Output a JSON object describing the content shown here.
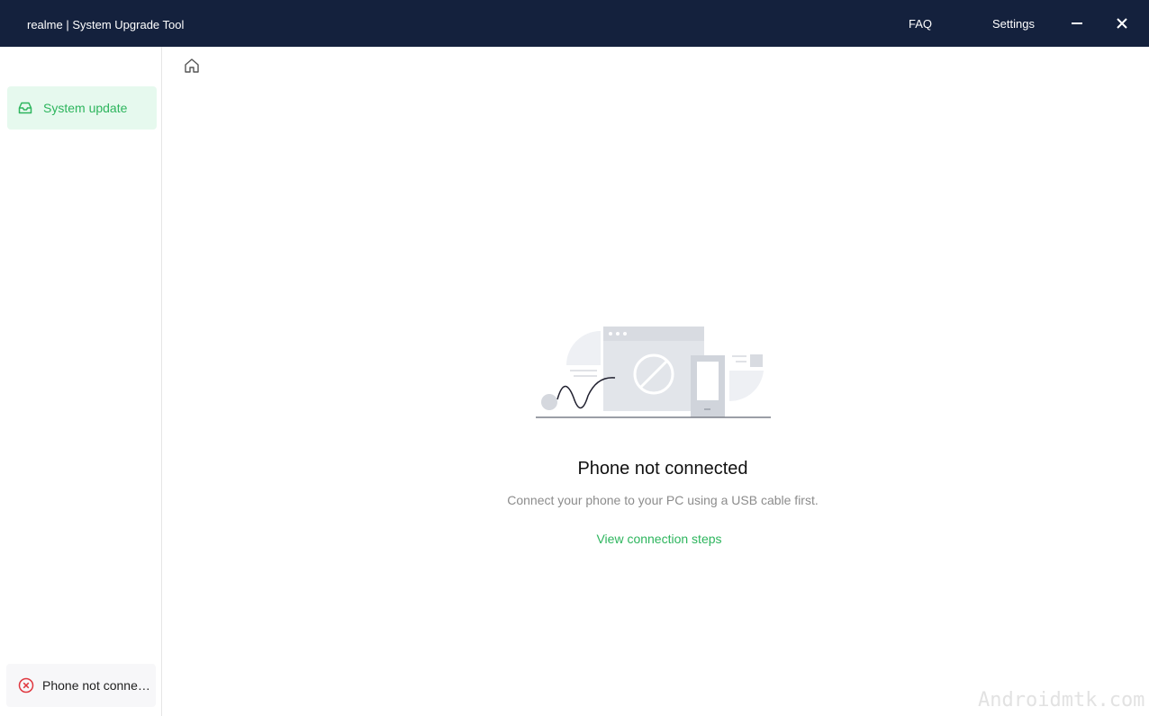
{
  "titlebar": {
    "app_title": "realme | System Upgrade Tool",
    "faq_label": "FAQ",
    "settings_label": "Settings",
    "minimize_icon": "minimize-icon",
    "close_icon": "close-icon"
  },
  "sidebar": {
    "items": [
      {
        "label": "System update",
        "icon": "inbox-icon",
        "active": true
      }
    ],
    "status": {
      "text": "Phone not connected",
      "icon": "error-circle-icon",
      "color": "#e0373f"
    }
  },
  "main": {
    "home_icon": "home-icon",
    "empty_state": {
      "title": "Phone not connected",
      "description": "Connect your phone to your PC using a USB cable first.",
      "link_label": "View connection steps"
    }
  },
  "watermark": "Androidmtk.com",
  "colors": {
    "titlebar": "#14213d",
    "accent": "#2db55d",
    "active_bg": "#e6f9ee",
    "error": "#e0373f"
  }
}
